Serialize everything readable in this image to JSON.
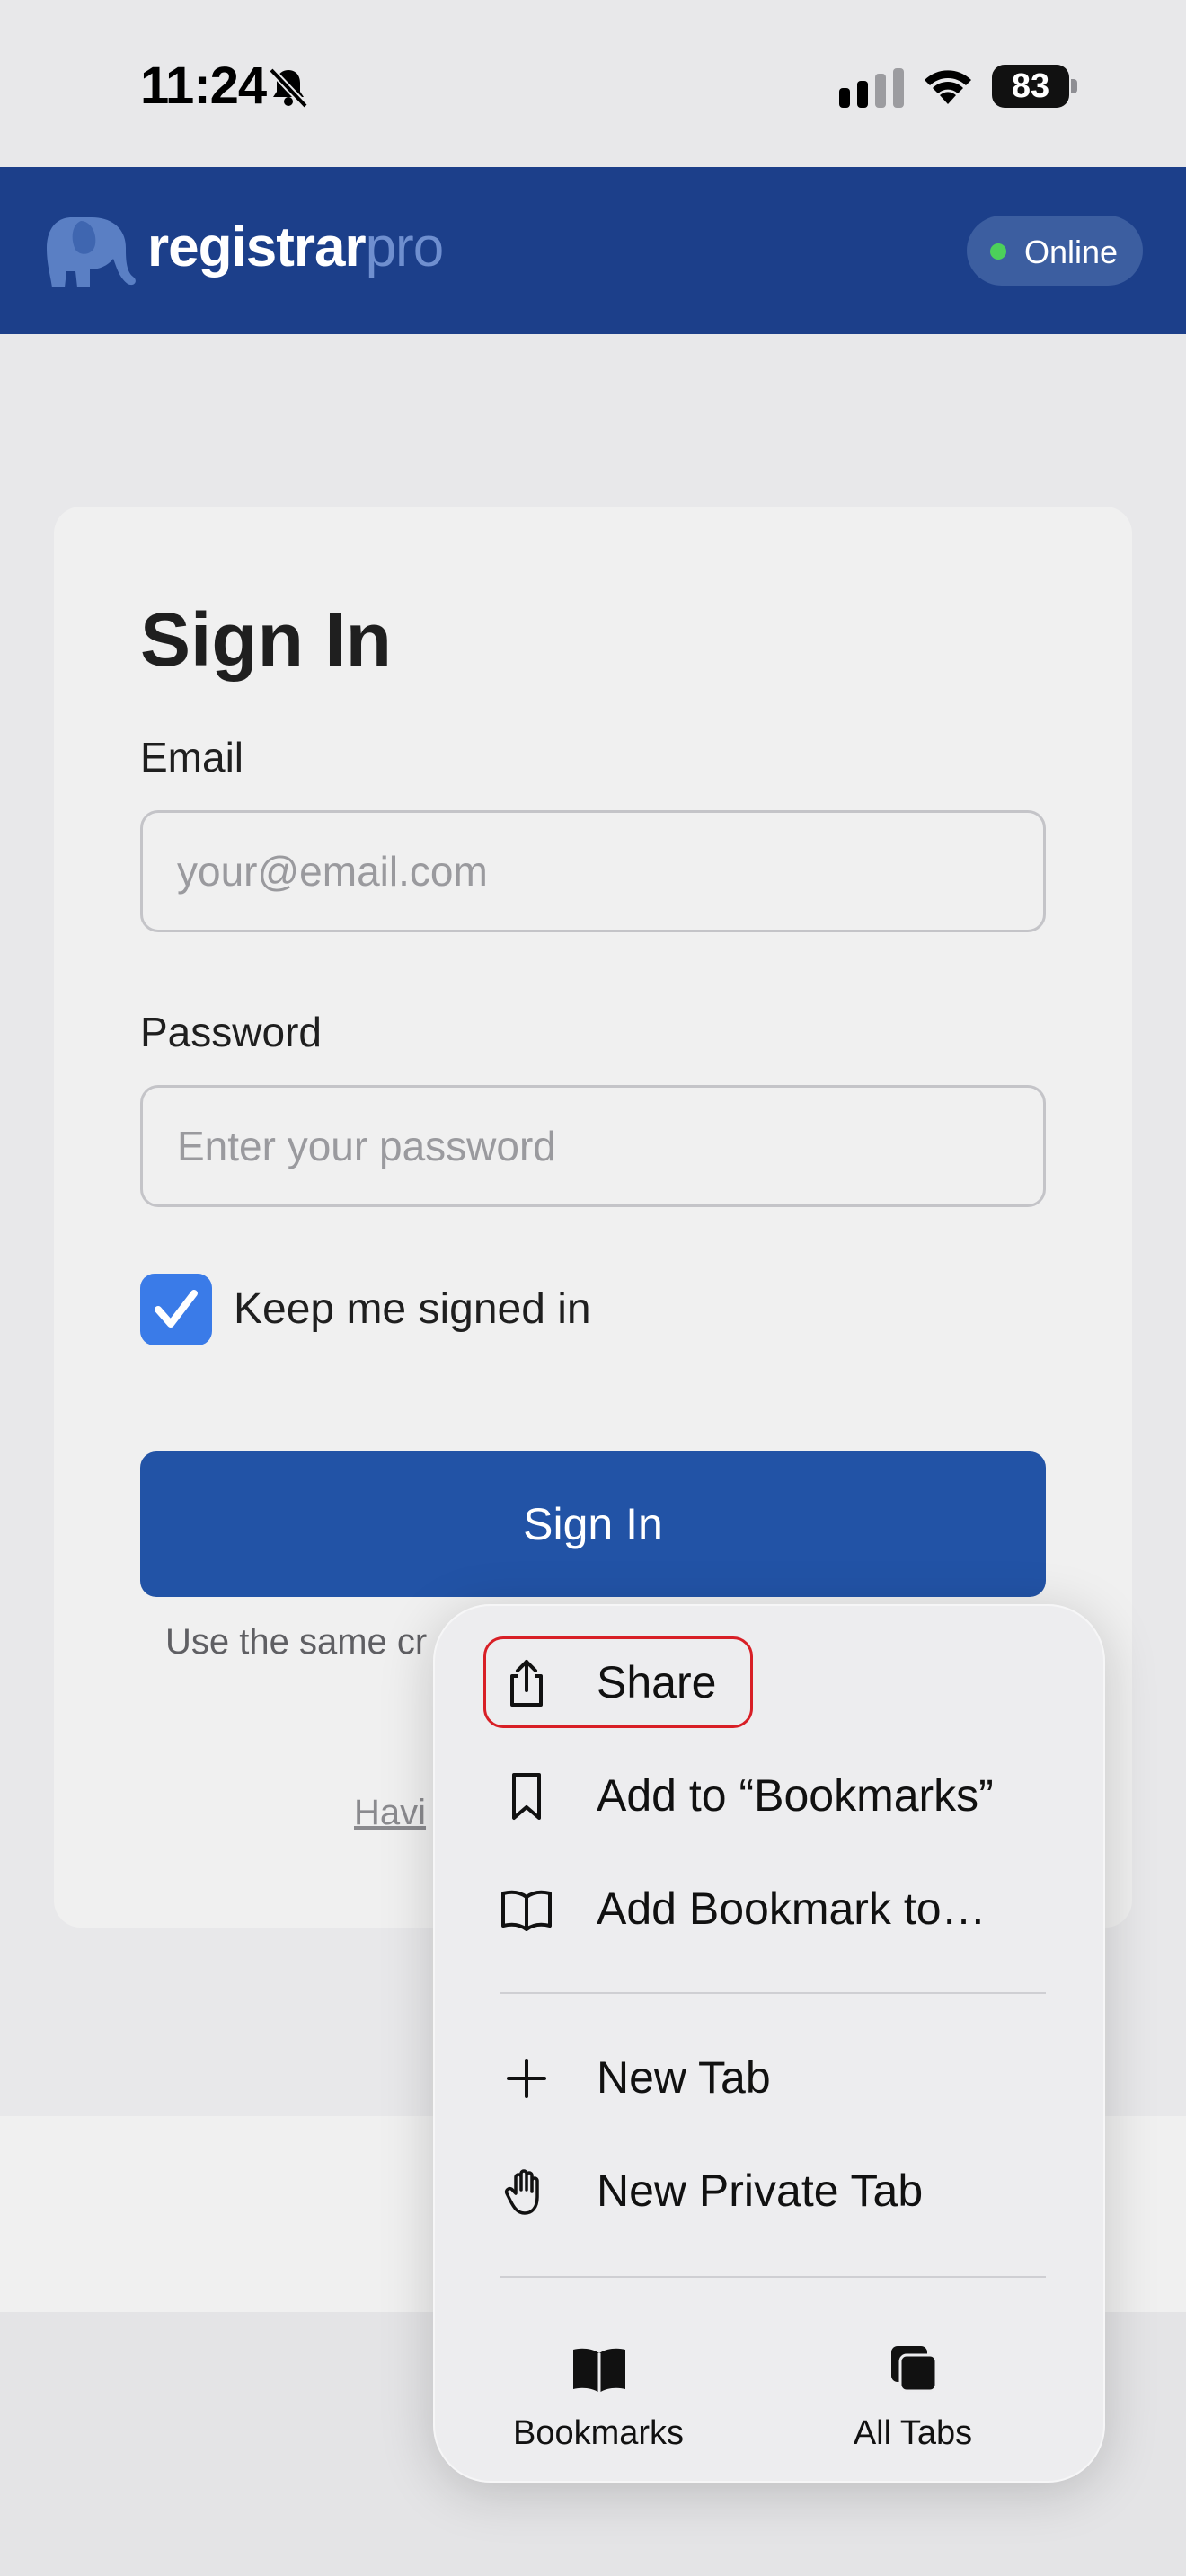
{
  "status_bar": {
    "time": "11:24",
    "battery": "83",
    "icons": [
      "bell-slash-icon",
      "cellular-signal-icon",
      "wifi-icon",
      "battery-icon"
    ]
  },
  "header": {
    "brand_primary": "registrar",
    "brand_secondary": "pro",
    "logo_icon": "elephant-logo-icon",
    "status_label": "Online",
    "status_color": "#4cd05a"
  },
  "signin": {
    "title": "Sign In",
    "email_label": "Email",
    "email_placeholder": "your@email.com",
    "password_label": "Password",
    "password_placeholder": "Enter your password",
    "keep_signed_in_label": "Keep me signed in",
    "keep_signed_in_checked": true,
    "submit_label": "Sign In",
    "hint_text": "Use the same cr",
    "help_link": "Havi"
  },
  "context_menu": {
    "items": [
      {
        "label": "Share",
        "icon": "share-icon",
        "highlighted": true
      },
      {
        "label": "Add to “Bookmarks”",
        "icon": "bookmark-icon"
      },
      {
        "label": "Add Bookmark to…",
        "icon": "book-open-icon"
      },
      {
        "label": "New Tab",
        "icon": "plus-icon"
      },
      {
        "label": "New Private Tab",
        "icon": "hand-icon"
      }
    ],
    "bottom_buttons": [
      {
        "label": "Bookmarks",
        "icon": "book-icon"
      },
      {
        "label": "All Tabs",
        "icon": "tabs-icon"
      }
    ]
  },
  "colors": {
    "header_bg": "#1c3f8a",
    "button_bg": "#2253a6",
    "checkbox_bg": "#3a7be8",
    "highlight_border": "#d81f26"
  }
}
